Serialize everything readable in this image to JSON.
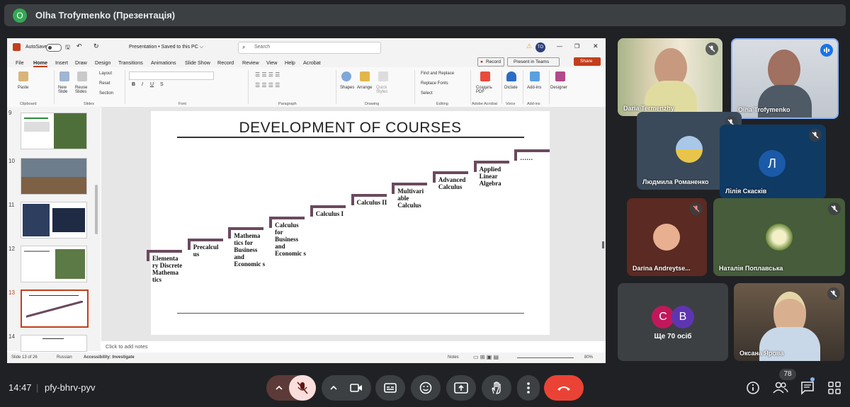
{
  "meeting": {
    "presenter_initial": "O",
    "presenter_title": "Olha Trofymenko (Презентація)",
    "time": "14:47",
    "code": "pfy-bhrv-pyv",
    "participant_count": "78"
  },
  "ppt": {
    "autosave": "AutoSave",
    "doc_title": "Presentation • Saved to this PC ⌵",
    "search_placeholder": "Search",
    "user_initials": "TO",
    "menu": [
      "File",
      "Home",
      "Insert",
      "Draw",
      "Design",
      "Transitions",
      "Animations",
      "Slide Show",
      "Record",
      "Review",
      "View",
      "Help",
      "Acrobat"
    ],
    "record_btn": "Record",
    "present_teams": "Present in Teams",
    "share_btn": "Share",
    "ribbon": {
      "paste": "Paste",
      "clipboard": "Clipboard",
      "new_slide": "New Slide",
      "reuse_slides": "Reuse Slides",
      "layout": "Layout",
      "reset": "Reset",
      "section": "Section",
      "slides": "Slides",
      "font": "Font",
      "paragraph": "Paragraph",
      "shapes": "Shapes",
      "arrange": "Arrange",
      "quick_styles": "Quick Styles",
      "drawing": "Drawing",
      "find_replace": "Find and Replace",
      "replace_fonts": "Replace Fonts",
      "select": "Select",
      "editing": "Editing",
      "create_pdf": "Создать PDF",
      "adobe_acrobat": "Adobe Acrobat",
      "dictate": "Dictate",
      "voice": "Voice",
      "addins": "Add-ins",
      "addins_grp": "Add-ins",
      "designer": "Designer"
    },
    "thumbnails": [
      "9",
      "10",
      "11",
      "12",
      "13",
      "14"
    ],
    "notes_placeholder": "Click to add notes",
    "status": {
      "slide_of": "Slide 13 of 26",
      "language": "Russian",
      "accessibility": "Accessibility: Investigate",
      "notes": "Notes",
      "zoom": "80%"
    }
  },
  "slide": {
    "title": "DEVELOPMENT OF COURSES",
    "steps": [
      "Elementa ry Discrete Mathema tics",
      "Precalcul us",
      "Mathema tics for Business and Economic s",
      "Calculus for Business and Economic s",
      "Calculus I",
      "Calculus II",
      "Multivari able Calculus",
      "Advanced Calculus",
      "Applied Linear Algebra",
      "……"
    ],
    "step_color": "#6b4a5e"
  },
  "participants": [
    {
      "name": "Daria Termenzhy"
    },
    {
      "name": "Olha Trofymenko"
    },
    {
      "name": "Людмила Романенко"
    },
    {
      "name": "Лілія Скасків",
      "initial": "Л"
    },
    {
      "name": "Darina Andreytse..."
    },
    {
      "name": "Наталія Поплавська"
    },
    {
      "name": "Ще 70 осіб",
      "initials": [
        "C",
        "B"
      ]
    },
    {
      "name": "Оксана Ярова"
    }
  ],
  "colors": {
    "hangup": "#ea4335",
    "mic_off": "#f9dedc",
    "mic_off_ctrl": "#5c3a38",
    "ppt_accent": "#c43e1c"
  }
}
